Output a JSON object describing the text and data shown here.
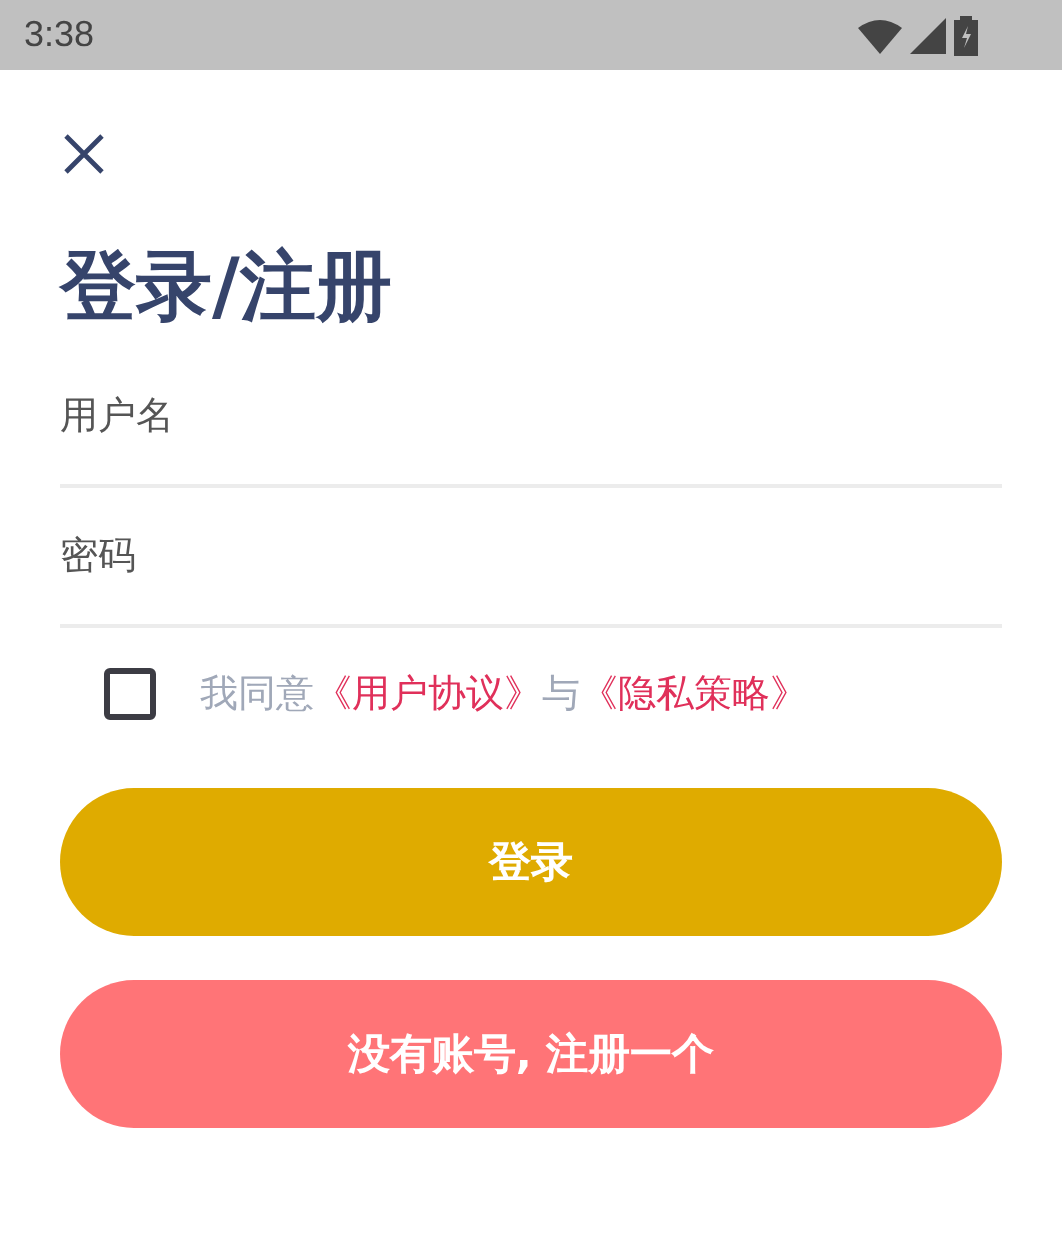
{
  "status_bar": {
    "time": "3:38"
  },
  "title": "登录/注册",
  "fields": [
    {
      "placeholder": "用户名"
    },
    {
      "placeholder": "密码"
    }
  ],
  "agreement": {
    "checked": false,
    "parts": [
      {
        "kind": "text",
        "text": "我同意"
      },
      {
        "kind": "link",
        "text": "《用户协议》"
      },
      {
        "kind": "text",
        "text": "与"
      },
      {
        "kind": "link",
        "text": "《隐私策略》"
      }
    ]
  },
  "buttons": [
    {
      "label": "登录",
      "kind": "primary"
    },
    {
      "label": "没有账号, 注册一个",
      "kind": "secondary"
    }
  ]
}
